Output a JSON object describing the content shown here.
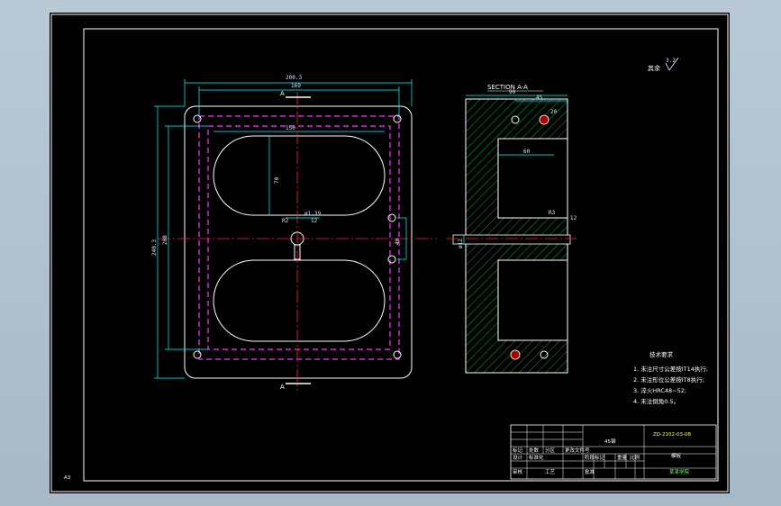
{
  "colors": {
    "background": "#000000",
    "frame": "#ffffff",
    "dimension": "#00ffff",
    "hidden_line": "#ff00ff",
    "center_line": "#ff0000",
    "hatch": "#00ff00",
    "title_green": "#00ff00",
    "title_yellow": "#ffff00"
  },
  "front_view": {
    "dims": {
      "overall_width": "200.3",
      "inner_width": "169",
      "pocket_width": "150",
      "pocket_height": "70",
      "hole_dia": "ø1.39",
      "center_hole": "12",
      "side_hole_span": "40",
      "overall_height": "240.3",
      "inner_height": "208",
      "corner_r": "R2"
    },
    "section_mark_top": "A",
    "section_mark_bottom": "A"
  },
  "section_view": {
    "title": "SECTION A-A",
    "dims": {
      "top_width": "90",
      "right_offset": "45",
      "hole_top": "20",
      "pocket_depth": "60",
      "slot_width": "12",
      "pipe_dia": "ø12",
      "radius": "R3"
    }
  },
  "roughness_note": "其余",
  "roughness_value": "3.2",
  "tech_requirements": {
    "title": "技术要求",
    "items": [
      "1. 未注尺寸公差按IT14执行;",
      "2. 未注形位公差按IT8执行;",
      "3. 淬火HRC48~52;",
      "4. 未注倒角0.5。"
    ]
  },
  "title_block": {
    "part_code": "ZD-2102-03-08",
    "material": "45钢",
    "part_name": "模板",
    "school": "某某学院",
    "row_labels": [
      "标记",
      "处数",
      "分区",
      "更改文件号",
      "签名",
      "年月日"
    ],
    "row_labels_2": [
      "设计",
      "标准化",
      "阶段标记",
      "重量",
      "比例"
    ],
    "row_labels_3": [
      "审核",
      "工艺",
      "批准",
      "共",
      "张",
      "第",
      "张"
    ]
  },
  "corner_label": "A3"
}
